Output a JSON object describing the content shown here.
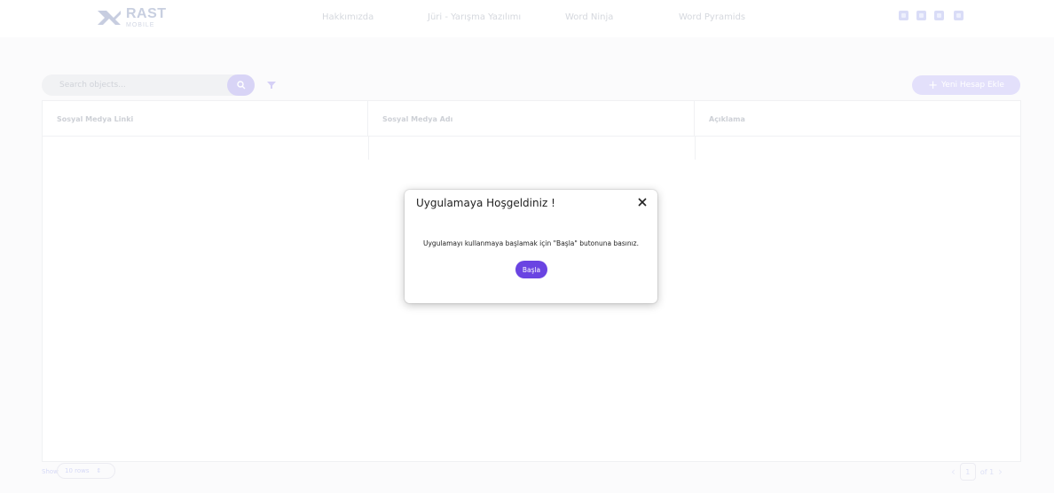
{
  "brand": {
    "name_top": "RAST",
    "name_bottom": "MOBILE"
  },
  "nav": {
    "links": [
      "Hakkımızda",
      "Jüri - Yarışma Yazılımı",
      "Word Ninja",
      "Word Pyramids"
    ],
    "social_icons": [
      "youtube-icon",
      "instagram-icon",
      "behance-icon",
      "linkedin-icon"
    ]
  },
  "toolbar": {
    "search_placeholder": "Search objects...",
    "search_icon": "search-icon",
    "filter_icon": "filter-icon",
    "new_button_label": "Yeni Hesap Ekle",
    "new_button_icon": "plus-icon"
  },
  "table": {
    "columns": [
      "Sosyal Medya Linki",
      "Sosyal Medya Adı",
      "Açıklama"
    ],
    "rows": []
  },
  "footer": {
    "show_label": "Show",
    "rows_per_page": "10 rows",
    "current_page": "1",
    "total_pages": "of 1"
  },
  "modal": {
    "title": "Uygulamaya Hoşgeldiniz !",
    "message": "Uygulamayı kullanmaya başlamak için \"Başla\" butonuna basınız.",
    "start_button_label": "Başla",
    "close_icon": "close-icon"
  },
  "colors": {
    "accent": "#6a44e2",
    "accent_faded": "#d8d4f6",
    "background": "#ffffff"
  }
}
